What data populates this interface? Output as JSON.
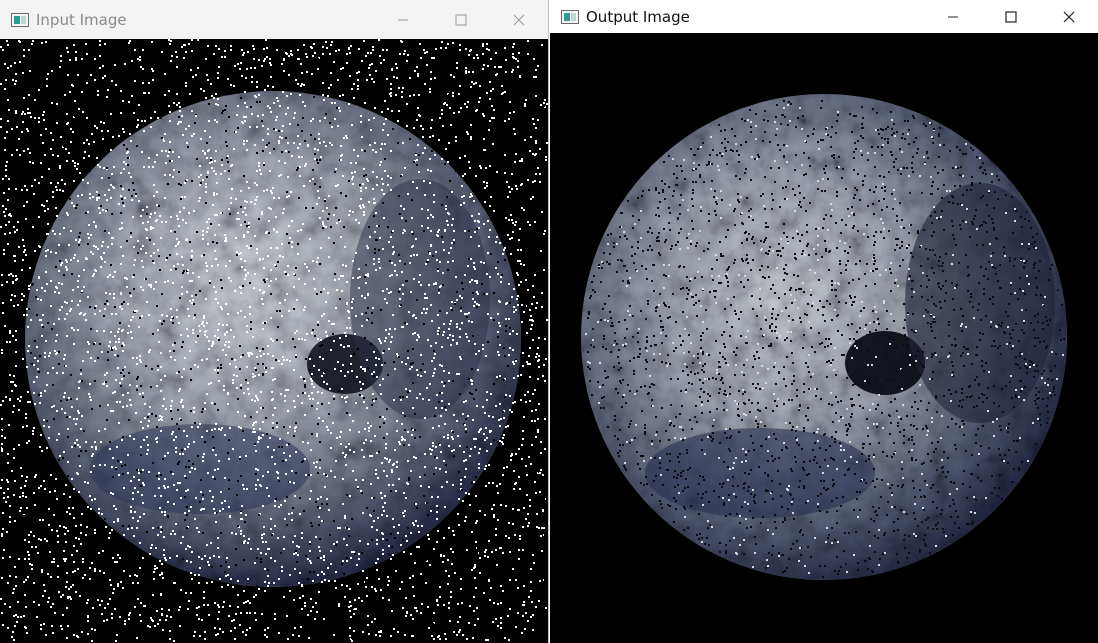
{
  "windows": [
    {
      "title": "Input Image",
      "active": false,
      "controls": [
        "minimize-icon",
        "maximize-icon",
        "close-icon"
      ],
      "image": "noisy Earth photograph with salt-and-pepper noise"
    },
    {
      "title": "Output Image",
      "active": true,
      "controls": [
        "minimize-icon",
        "maximize-icon",
        "close-icon"
      ],
      "image": "filtered Earth photograph"
    }
  ],
  "colors": {
    "canvas_bg": "#000000",
    "earth_light": "#cfd3d6",
    "earth_mid": "#7c8290",
    "earth_dark": "#2b2f4a",
    "noise": "#ffffff",
    "inactive_title": "#8a8a8a",
    "active_title": "#111111"
  }
}
